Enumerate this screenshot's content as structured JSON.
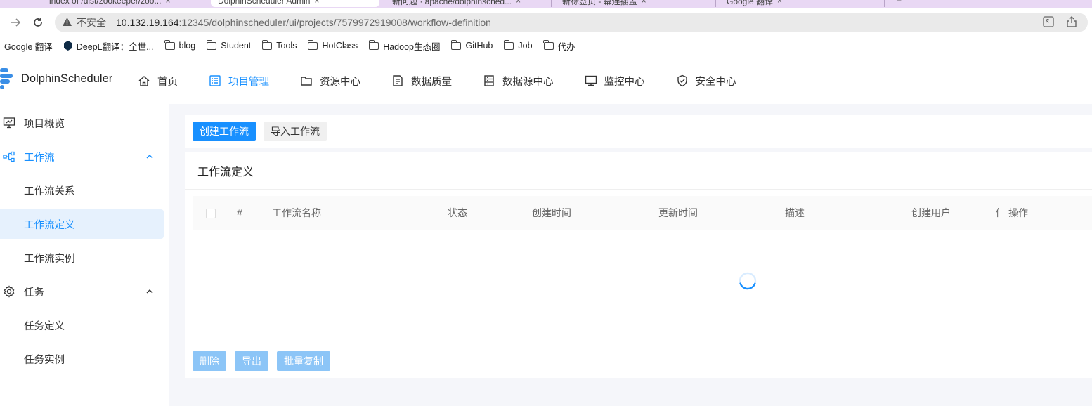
{
  "browser": {
    "tabs": [
      {
        "label": "index of /dist/zookeeper/zoo...",
        "close": "×"
      },
      {
        "label": "DolphinScheduler Admin",
        "close": "×"
      },
      {
        "label": "新问题 · apache/dolphinsched...",
        "close": "×"
      },
      {
        "label": "新标签页 - 幕连插盖",
        "close": "×"
      },
      {
        "label": "Google 翻译",
        "close": "×"
      }
    ],
    "new_tab": "+",
    "security_label": "不安全",
    "url_host": "10.132.19.164",
    "url_rest": ":12345/dolphinscheduler/ui/projects/7579972919008/workflow-definition",
    "bookmarks": [
      {
        "label": "Google 翻译",
        "type": "link"
      },
      {
        "label": "DeepL翻译：全世...",
        "type": "deepl"
      },
      {
        "label": "blog",
        "type": "folder"
      },
      {
        "label": "Student",
        "type": "folder"
      },
      {
        "label": "Tools",
        "type": "folder"
      },
      {
        "label": "HotClass",
        "type": "folder"
      },
      {
        "label": "Hadoop生态圈",
        "type": "folder"
      },
      {
        "label": "GitHub",
        "type": "folder"
      },
      {
        "label": "Job",
        "type": "folder"
      },
      {
        "label": "代办",
        "type": "folder"
      }
    ]
  },
  "app": {
    "logo_text": "DolphinScheduler",
    "nav": [
      {
        "label": "首页",
        "icon": "home-icon",
        "active": false
      },
      {
        "label": "项目管理",
        "icon": "project-list-icon",
        "active": true
      },
      {
        "label": "资源中心",
        "icon": "folder-icon",
        "active": false
      },
      {
        "label": "数据质量",
        "icon": "document-icon",
        "active": false
      },
      {
        "label": "数据源中心",
        "icon": "database-icon",
        "active": false
      },
      {
        "label": "监控中心",
        "icon": "monitor-icon",
        "active": false
      },
      {
        "label": "安全中心",
        "icon": "shield-icon",
        "active": false
      }
    ],
    "accent_color": "#1890ff"
  },
  "sidebar": {
    "items": [
      {
        "label": "项目概览",
        "level": 1,
        "icon": "overview-icon"
      },
      {
        "label": "工作流",
        "level": 1,
        "icon": "workflow-icon",
        "expanded": true
      },
      {
        "label": "工作流关系",
        "level": 2
      },
      {
        "label": "工作流定义",
        "level": 2,
        "selected": true
      },
      {
        "label": "工作流实例",
        "level": 2
      },
      {
        "label": "任务",
        "level": 1,
        "icon": "gear-icon",
        "expanded": true
      },
      {
        "label": "任务定义",
        "level": 2
      },
      {
        "label": "任务实例",
        "level": 2
      }
    ]
  },
  "main": {
    "create_button": "创建工作流",
    "import_button": "导入工作流",
    "card_title": "工作流定义",
    "columns": [
      "#",
      "工作流名称",
      "状态",
      "创建时间",
      "更新时间",
      "描述",
      "创建用户",
      "修",
      "操作"
    ],
    "loading": true,
    "footer_buttons": [
      "删除",
      "导出",
      "批量复制"
    ]
  }
}
